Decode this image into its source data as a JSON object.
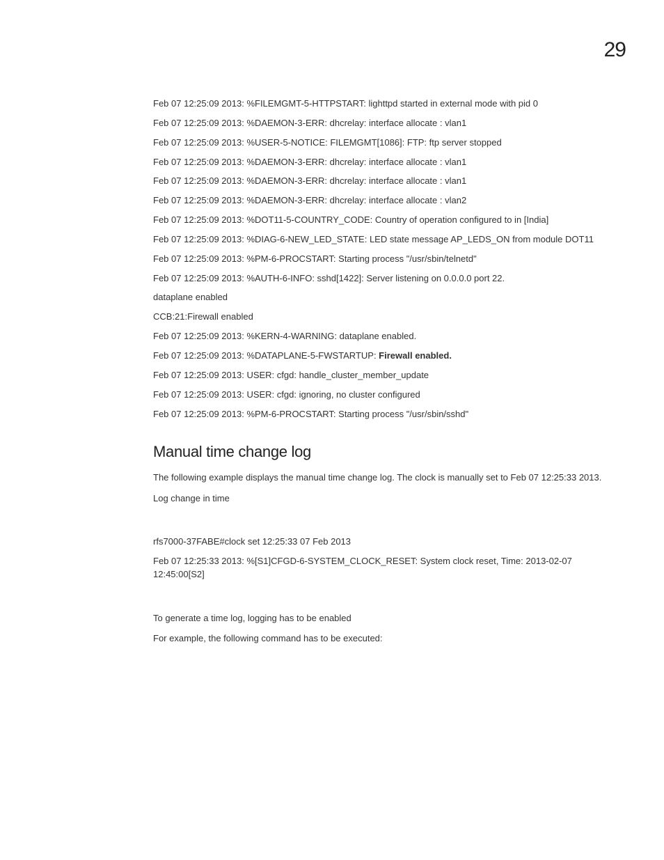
{
  "pageNumber": "29",
  "logs": [
    "Feb 07 12:25:09 2013: %FILEMGMT-5-HTTPSTART: lighttpd started in external mode with pid 0",
    "Feb 07 12:25:09 2013: %DAEMON-3-ERR: dhcrelay: interface allocate : vlan1",
    "Feb 07 12:25:09 2013: %USER-5-NOTICE: FILEMGMT[1086]: FTP: ftp server stopped",
    "Feb 07 12:25:09 2013: %DAEMON-3-ERR: dhcrelay: interface allocate : vlan1",
    "Feb 07 12:25:09 2013: %DAEMON-3-ERR: dhcrelay: interface allocate : vlan1",
    "Feb 07 12:25:09 2013: %DAEMON-3-ERR: dhcrelay: interface allocate : vlan2",
    "Feb 07 12:25:09 2013: %DOT11-5-COUNTRY_CODE: Country of operation configured to in [India]",
    "Feb 07 12:25:09 2013: %DIAG-6-NEW_LED_STATE: LED state message AP_LEDS_ON from module DOT11",
    "Feb 07 12:25:09 2013: %PM-6-PROCSTART: Starting process \"/usr/sbin/telnetd\"",
    "Feb 07 12:25:09 2013: %AUTH-6-INFO: sshd[1422]: Server listening on 0.0.0.0 port 22.",
    "dataplane enabled",
    "CCB:21:Firewall enabled",
    "Feb 07 12:25:09 2013: %KERN-4-WARNING: dataplane enabled."
  ],
  "fwLine": {
    "prefix": "Feb 07 12:25:09 2013: %DATAPLANE-5-FWSTARTUP: ",
    "bold": "Firewall enabled."
  },
  "logs2": [
    "Feb 07 12:25:09 2013: USER: cfgd: handle_cluster_member_update",
    "Feb 07 12:25:09 2013: USER: cfgd: ignoring, no cluster configured",
    "Feb 07 12:25:09 2013: %PM-6-PROCSTART: Starting process \"/usr/sbin/sshd\""
  ],
  "heading": "Manual time change log",
  "intro": "The following example displays the manual time change log. The clock is manually set to Feb 07 12:25:33 2013.",
  "logChange": "Log change in time",
  "clockCmd": "rfs7000-37FABE#clock set 12:25:33 07 Feb 2013",
  "clockResult": "Feb 07 12:25:33 2013: %[S1]CFGD-6-SYSTEM_CLOCK_RESET: System clock reset, Time: 2013-02-07 12:45:00[S2]",
  "note1": "To generate a time log, logging has to be enabled",
  "note2": "For example, the following command has to be executed:"
}
